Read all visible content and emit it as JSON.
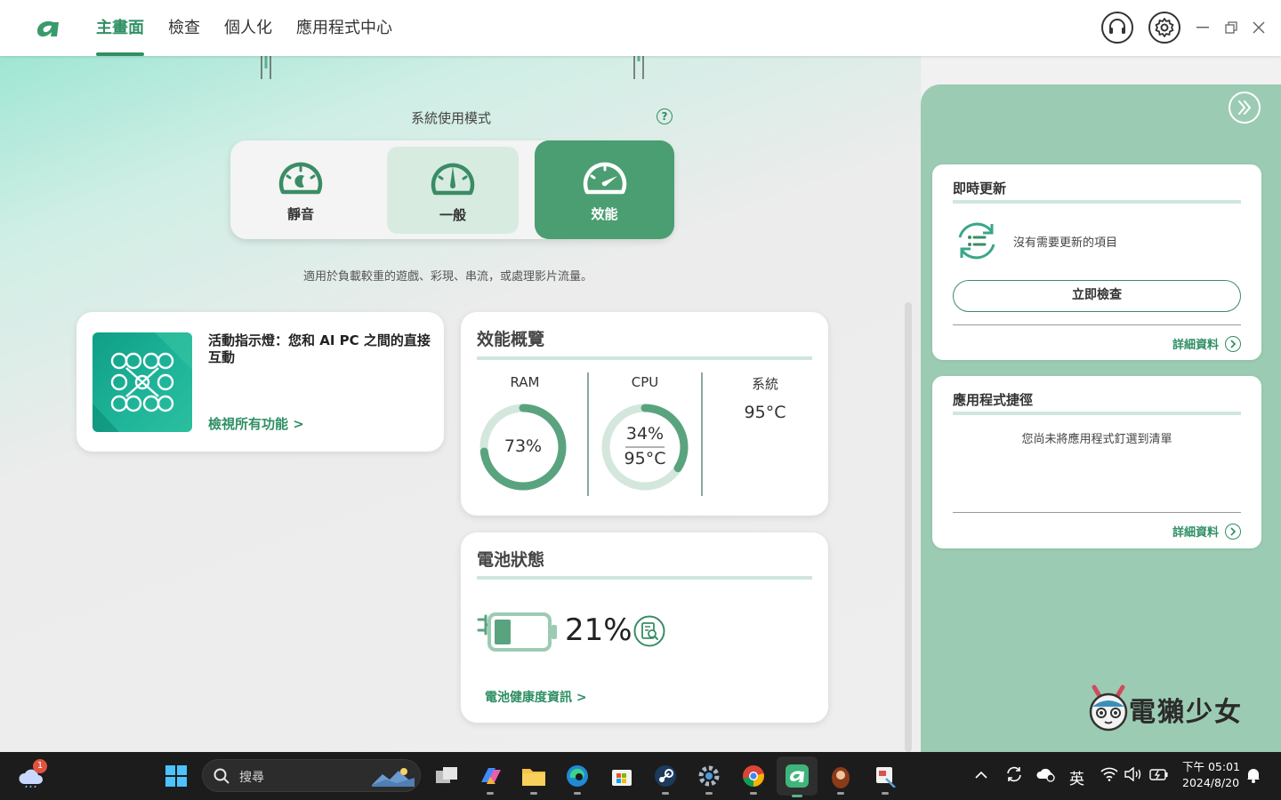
{
  "titlebar": {
    "tabs": [
      "主畫面",
      "檢查",
      "個人化",
      "應用程式中心"
    ],
    "active_tab": 0
  },
  "mode": {
    "title": "系統使用模式",
    "help_glyph": "?",
    "options": [
      "靜音",
      "一般",
      "效能"
    ],
    "selected": "效能",
    "description": "適用於負載較重的遊戲、彩現、串流，或處理影片流量。"
  },
  "activity": {
    "title": "活動指示燈：您和 AI PC 之間的直接互動",
    "link": "檢視所有功能 >"
  },
  "performance": {
    "title": "效能概覽",
    "ram_label": "RAM",
    "ram_value": "73%",
    "ram_percent": 73,
    "cpu_label": "CPU",
    "cpu_value": "34%",
    "cpu_percent": 34,
    "cpu_temp": "95°C",
    "system_label": "系統",
    "system_temp": "95°C"
  },
  "battery": {
    "title": "電池狀態",
    "percent_text": "21%",
    "percent": 21,
    "link": "電池健康度資訊 >"
  },
  "updates": {
    "title": "即時更新",
    "status": "沒有需要更新的項目",
    "button": "立即檢查",
    "details": "詳細資料"
  },
  "shortcuts": {
    "title": "應用程式捷徑",
    "empty": "您尚未將應用程式釘選到清單",
    "details": "詳細資料"
  },
  "watermark": "電獺少女",
  "taskbar": {
    "search_placeholder": "搜尋",
    "weather_badge": "1",
    "ime": "英",
    "time": "下午 05:01",
    "date": "2024/8/20"
  },
  "colors": {
    "accent": "#2f8f64",
    "mode_selected": "#4a9e72",
    "right_panel": "#9ccbb3",
    "gauge_track": "#d3e7dd",
    "gauge_fill": "#5aa37f"
  }
}
